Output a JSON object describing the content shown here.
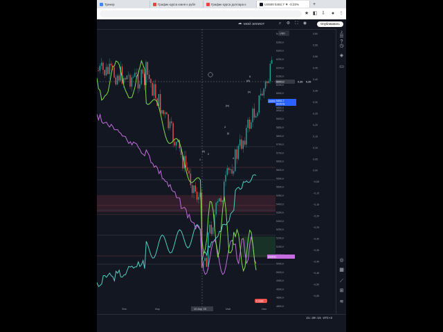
{
  "browser": {
    "tabs": [
      {
        "title": "Трекер",
        "color": "#4285f4",
        "active": false
      },
      {
        "title": "График курса юаня к рубл",
        "color": "#e8453c",
        "active": false
      },
      {
        "title": "График курса доллара к",
        "color": "#e8453c",
        "active": false
      },
      {
        "title": "US500 5492,7 ▼ -0,33%",
        "color": "#131722",
        "active": true
      }
    ],
    "new_tab_label": "+"
  },
  "header": {
    "realtime_label": "МОЙ ЭЛЛИОТ",
    "publish_label": "Опубликовать",
    "currency_label": "USD"
  },
  "chart_data": {
    "type": "line",
    "price_axis_ticks": [
      "6400,0",
      "6350,0",
      "6300,0",
      "6250,0",
      "6200,0",
      "6150,0",
      "6100,0",
      "6050,0",
      "6000,0",
      "5950,0",
      "5900,0",
      "5850,0",
      "5800,0",
      "5750,0",
      "5700,0",
      "5650,0",
      "5600,0",
      "5550,0",
      "5500,0",
      "5450,0",
      "5400,0",
      "5350,0",
      "5300,0",
      "5250,0",
      "5200,0",
      "5150,0",
      "5100,0",
      "5050,0",
      "5000,0",
      "4950,0",
      "4900,0",
      "4850,0",
      "4800,0"
    ],
    "indicator_axis_ticks": [
      "0,60",
      "0,55",
      "0,50",
      "0,45",
      "0,40",
      "0,35",
      "0,30",
      "0,25",
      "0,20",
      "0,15",
      "0,10",
      "0,05",
      "0,00",
      "−0,05",
      "−0,10",
      "−0,15",
      "−0,20",
      "−0,25",
      "−0,30",
      "−0,35",
      "−0,40",
      "−0,45",
      "−0,50",
      "−0,55"
    ],
    "time_labels": [
      "Фев",
      "Мар",
      "Апр",
      "Май",
      "Июн"
    ],
    "crosshair_date": "10 Апр '25",
    "crosshair_price": "6000,0",
    "crosshair_values": [
      "0,39",
      "0,39"
    ],
    "last_price": {
      "symbol": "US500",
      "price": "5492,7",
      "change": "00:29:41",
      "price2": "5850,0"
    },
    "marker_label": "US0011",
    "bottom_badge": "5 2333",
    "series_colors": {
      "green": "#7ee04a",
      "violet": "#c56ce0",
      "cyan": "#4fd1c5",
      "up": "#26a69a",
      "down": "#ef5350"
    },
    "elliott_labels": [
      "(i)",
      "(ii)",
      "(iii)",
      "(iv)",
      "(v)",
      "1",
      "2",
      "3",
      "4",
      "5"
    ]
  },
  "footer": {
    "clock": "21:30:15 UTC+3"
  },
  "icons": [
    "list-icon",
    "clock-icon",
    "layers-icon",
    "chat-icon",
    "target-icon",
    "calendar-icon",
    "ruler-icon",
    "grid-icon",
    "broadcast-icon",
    "bell-icon",
    "help-icon"
  ]
}
